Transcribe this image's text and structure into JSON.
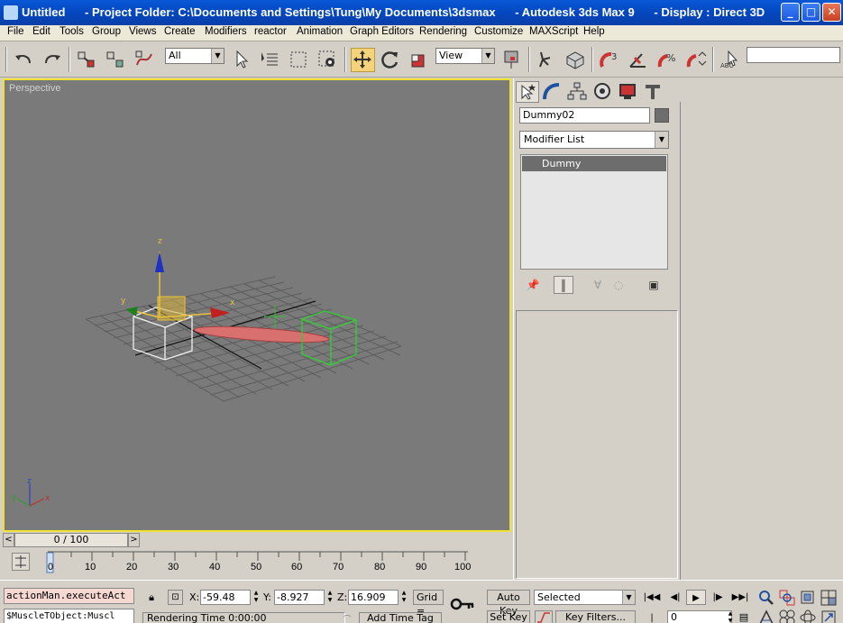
{
  "window": {
    "title": "Untitled      - Project Folder: C:\\Documents and Settings\\Tung\\My Documents\\3dsmax      - Autodesk 3ds Max 9      - Display : Direct 3D",
    "minimize": "_",
    "maximize": "□",
    "close": "✕"
  },
  "menu": [
    "File",
    "Edit",
    "Tools",
    "Group",
    "Views",
    "Create",
    "Modifiers",
    "reactor",
    "Animation",
    "Graph Editors",
    "Rendering",
    "Customize",
    "MAXScript",
    "Help"
  ],
  "toolbar": {
    "selection_filter": "All",
    "reference_coord": "View"
  },
  "viewport": {
    "label": "Perspective",
    "axis_gizmo": {
      "x": "x",
      "y": "y",
      "z": "z"
    }
  },
  "time_slider": {
    "value": "0 / 100",
    "left_arrow": "<",
    "right_arrow": ">"
  },
  "track_bar": {
    "ticks": [
      "0",
      "10",
      "20",
      "30",
      "40",
      "50",
      "60",
      "70",
      "80",
      "90",
      "100"
    ]
  },
  "command_panel": {
    "object_name": "Dummy02",
    "modifier_list": "Modifier List",
    "stack_items": [
      "Dummy"
    ],
    "object_color": "#6e6e6e"
  },
  "status": {
    "listener_line1": "actionMan.executeAct",
    "listener_line2": "$MuscleTObject:Muscl",
    "x_label": "X:",
    "x_value": "-59.48",
    "y_label": "Y:",
    "y_value": "-8.927",
    "z_label": "Z:",
    "z_value": "16.909",
    "grid_label": "Grid =",
    "prompt": "Rendering Time  0:00:00",
    "add_time_tag": "Add Time Tag",
    "auto_key": "Auto Key",
    "set_key": "Set Key",
    "selected": "Selected",
    "key_filters": "Key Filters...",
    "frame": "0"
  },
  "colors": {
    "viewport_bg": "#7a7a7a",
    "viewport_border": "#f0e030",
    "panel_bg": "#d4d0c8",
    "titlebar": "#0a58d6"
  }
}
